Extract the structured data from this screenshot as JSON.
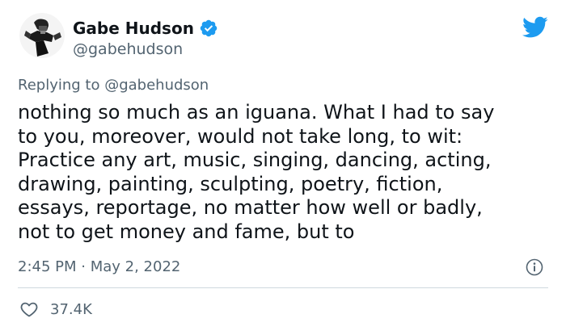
{
  "author": {
    "display_name": "Gabe Hudson",
    "handle": "@gabehudson",
    "verified": true
  },
  "reply": {
    "prefix": "Replying to ",
    "mention": "@gabehudson"
  },
  "tweet": {
    "lines": [
      "nothing so much as an iguana. What I had to say",
      "to you, moreover, would not take long, to wit:",
      "Practice any art, music, singing, dancing, acting,",
      "drawing, painting, sculpting, poetry, fiction,",
      "essays, reportage, no matter how well or badly,",
      "not to get money and fame, but to"
    ]
  },
  "meta": {
    "time": "2:45 PM",
    "separator": " · ",
    "date": "May 2, 2022"
  },
  "engagement": {
    "likes": "37.4K"
  },
  "colors": {
    "brand_blue": "#1d9bf0",
    "text_primary": "#0f1419",
    "text_secondary": "#536471",
    "divider": "#cfd9de"
  },
  "icons": {
    "twitter_logo": "twitter-bird-icon",
    "verified": "verified-badge-icon",
    "info": "info-icon",
    "like": "heart-icon"
  }
}
